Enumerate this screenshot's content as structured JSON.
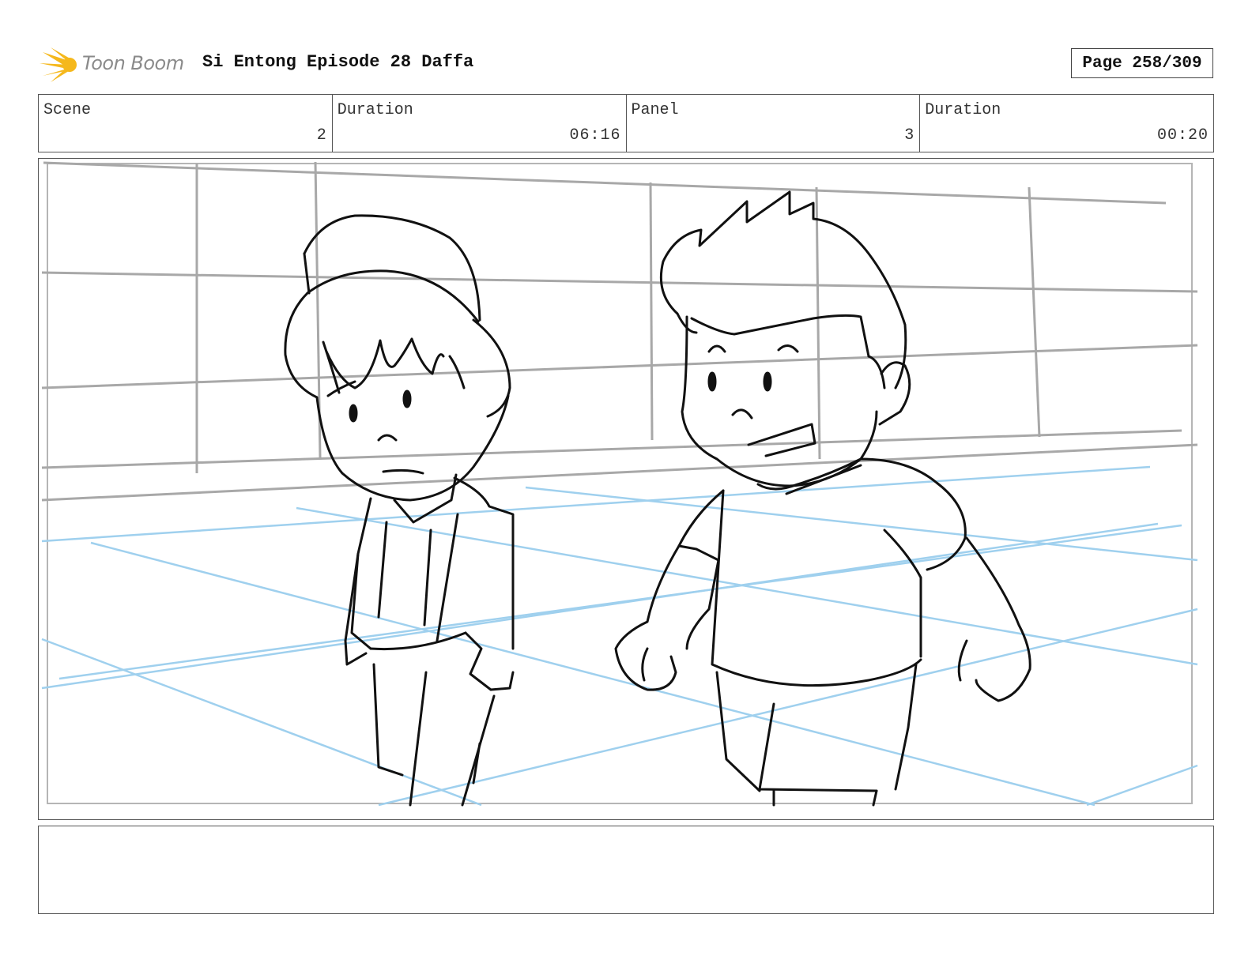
{
  "header": {
    "logo_text": "Toon Boom",
    "title": "Si Entong Episode 28 Daffa",
    "page_label": "Page 258/309"
  },
  "info": {
    "scene_label": "Scene",
    "scene_value": "2",
    "scene_duration_label": "Duration",
    "scene_duration_value": "06:16",
    "panel_label": "Panel",
    "panel_value": "3",
    "panel_duration_label": "Duration",
    "panel_duration_value": "00:20"
  },
  "notes": {
    "text": ""
  },
  "colors": {
    "logo_accent": "#f5b81c",
    "sketch_line": "#111111",
    "guide_gray": "#a8a8a8",
    "guide_blue": "#9fd0ee"
  }
}
